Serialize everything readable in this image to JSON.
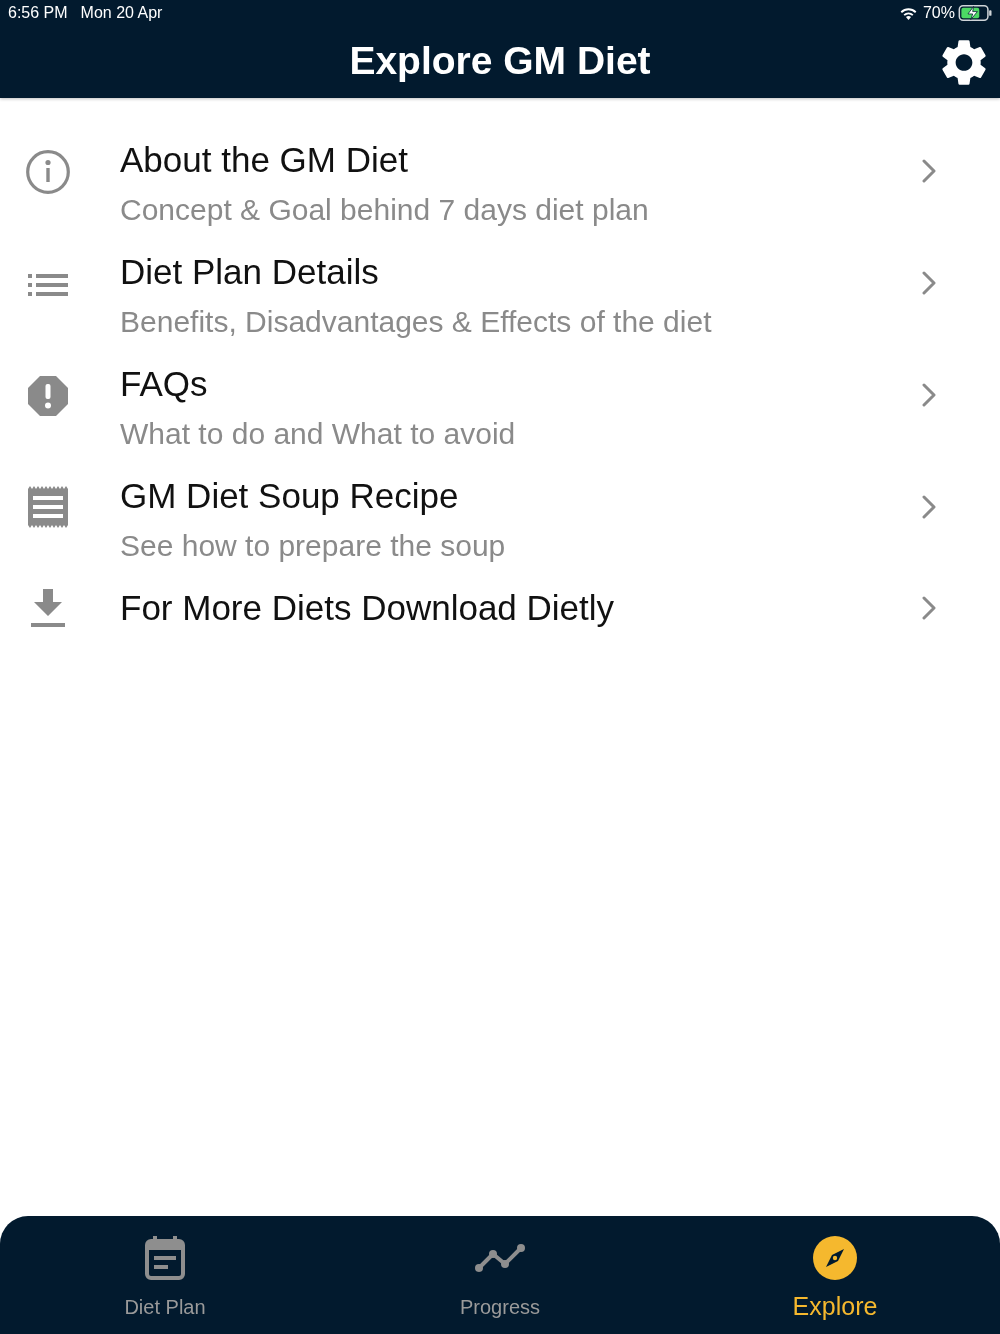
{
  "status_bar": {
    "time": "6:56 PM",
    "date": "Mon 20 Apr",
    "battery": "70%"
  },
  "header": {
    "title": "Explore GM Diet"
  },
  "menu": [
    {
      "title": "About the GM Diet",
      "subtitle": "Concept & Goal behind 7 days diet plan"
    },
    {
      "title": "Diet Plan Details",
      "subtitle": "Benefits, Disadvantages & Effects of the diet"
    },
    {
      "title": "FAQs",
      "subtitle": "What to do and What to avoid"
    },
    {
      "title": "GM Diet Soup Recipe",
      "subtitle": "See how to prepare the soup"
    },
    {
      "title": "For More Diets Download Dietly"
    }
  ],
  "tab_bar": [
    {
      "label": "Diet Plan",
      "selected": false
    },
    {
      "label": "Progress",
      "selected": false
    },
    {
      "label": "Explore",
      "selected": true
    }
  ]
}
